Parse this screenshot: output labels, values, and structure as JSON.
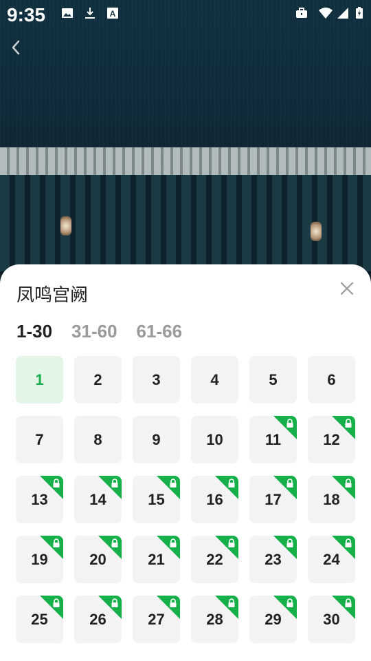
{
  "status_bar": {
    "time": "9:35",
    "left_icons": [
      "image-icon",
      "download-icon",
      "text-a-icon"
    ],
    "right_icons": [
      "briefcase-icon",
      "wifi-icon",
      "signal-icon",
      "battery-icon"
    ]
  },
  "player": {
    "back_icon": "chevron-left-icon"
  },
  "sheet": {
    "title": "凤鸣宫阙",
    "close_icon": "close-icon",
    "tabs": [
      {
        "label": "1-30",
        "active": true
      },
      {
        "label": "31-60",
        "active": false
      },
      {
        "label": "61-66",
        "active": false
      }
    ],
    "episodes": [
      {
        "num": "1",
        "current": true,
        "locked": false
      },
      {
        "num": "2",
        "current": false,
        "locked": false
      },
      {
        "num": "3",
        "current": false,
        "locked": false
      },
      {
        "num": "4",
        "current": false,
        "locked": false
      },
      {
        "num": "5",
        "current": false,
        "locked": false
      },
      {
        "num": "6",
        "current": false,
        "locked": false
      },
      {
        "num": "7",
        "current": false,
        "locked": false
      },
      {
        "num": "8",
        "current": false,
        "locked": false
      },
      {
        "num": "9",
        "current": false,
        "locked": false
      },
      {
        "num": "10",
        "current": false,
        "locked": false
      },
      {
        "num": "11",
        "current": false,
        "locked": true
      },
      {
        "num": "12",
        "current": false,
        "locked": true
      },
      {
        "num": "13",
        "current": false,
        "locked": true
      },
      {
        "num": "14",
        "current": false,
        "locked": true
      },
      {
        "num": "15",
        "current": false,
        "locked": true
      },
      {
        "num": "16",
        "current": false,
        "locked": true
      },
      {
        "num": "17",
        "current": false,
        "locked": true
      },
      {
        "num": "18",
        "current": false,
        "locked": true
      },
      {
        "num": "19",
        "current": false,
        "locked": true
      },
      {
        "num": "20",
        "current": false,
        "locked": true
      },
      {
        "num": "21",
        "current": false,
        "locked": true
      },
      {
        "num": "22",
        "current": false,
        "locked": true
      },
      {
        "num": "23",
        "current": false,
        "locked": true
      },
      {
        "num": "24",
        "current": false,
        "locked": true
      },
      {
        "num": "25",
        "current": false,
        "locked": true
      },
      {
        "num": "26",
        "current": false,
        "locked": true
      },
      {
        "num": "27",
        "current": false,
        "locked": true
      },
      {
        "num": "28",
        "current": false,
        "locked": true
      },
      {
        "num": "29",
        "current": false,
        "locked": true
      },
      {
        "num": "30",
        "current": false,
        "locked": true
      }
    ],
    "colors": {
      "accent": "#15b04a",
      "current_bg": "#e2f5e6",
      "cell_bg": "#f3f3f3",
      "text": "#222222",
      "tab_inactive": "#9a9a9a"
    }
  }
}
